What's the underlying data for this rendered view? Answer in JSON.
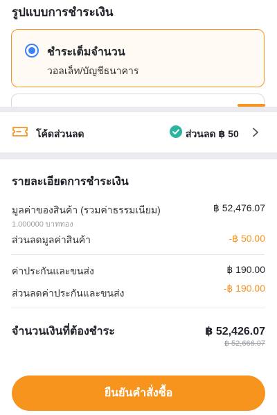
{
  "payment_method": {
    "title": "รูปแบบการชำระเงิน",
    "selected_option": {
      "title": "ชำระเต็มจำนวน",
      "subtitle": "วอลเล็ท/บัญชีธนาคาร"
    }
  },
  "discount": {
    "label": "โค้ดส่วนลด",
    "value": "ส่วนลด ฿ 50",
    "icons": {
      "left": "ticket-icon",
      "status": "check-circle-icon",
      "action": "chevron-right-icon"
    }
  },
  "details": {
    "title": "รายละเอียดการชำระเงิน",
    "rows": [
      {
        "label": "มูลค่าของสินค้า (รวมค่าธรรมเนียม)",
        "sub": "1.000000 บาททอง",
        "value": "฿ 52,476.07"
      },
      {
        "label": "ส่วนลดมูลค่าสินค้า",
        "value": "-฿ 50.00"
      },
      {
        "label": "ค่าประกันและขนส่ง",
        "value": "฿ 190.00"
      },
      {
        "label": "ส่วนลดค่าประกันและขนส่ง",
        "value": "-฿ 190.00"
      }
    ],
    "total": {
      "label": "จำนวนเงินที่ต้องชำระ",
      "value": "฿ 52,426.07",
      "original": "฿ 52,666.07"
    }
  },
  "confirm_button": {
    "label": "ยืนยันคำสั่งซื้อ"
  },
  "colors": {
    "accent": "#f7941e",
    "radio": "#3b82f6",
    "success": "#2bb5a0",
    "separator": "#e9ebee"
  }
}
